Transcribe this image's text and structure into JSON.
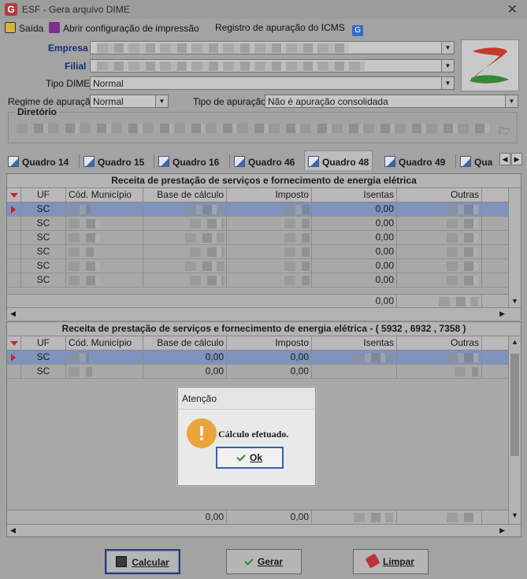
{
  "window": {
    "title": "ESF - Gera arquivo DIME",
    "close_symbol": "✕"
  },
  "toolbar": {
    "exit_label": "Saída",
    "print_config_label": "Abrir configuração de impressão",
    "icms_register_label": "Registro de apuração do ICMS"
  },
  "form": {
    "empresa_label": "Empresa",
    "filial_label": "Filial",
    "tipo_dime_label": "Tipo DIME",
    "tipo_dime_value": "Normal",
    "regime_label": "Regime de apuração",
    "regime_value": "Normal",
    "tipo_apuracao_label": "Tipo de apuração",
    "tipo_apuracao_value": "Não é apuração consolidada",
    "diretorio_label": "Diretório"
  },
  "tabs": [
    {
      "label": "Quadro 14"
    },
    {
      "label": "Quadro 15"
    },
    {
      "label": "Quadro 16"
    },
    {
      "label": "Quadro 46"
    },
    {
      "label": "Quadro 48",
      "active": true
    },
    {
      "label": "Quadro 49"
    },
    {
      "label": "Qua"
    }
  ],
  "grid1": {
    "title": "Receita de prestação de serviços e fornecimento de energia elétrica",
    "columns": [
      "UF",
      "Cód. Município",
      "Base de cálculo",
      "Imposto",
      "Isentas",
      "Outras"
    ],
    "rows": [
      {
        "uf": "SC",
        "isentas": "0,00"
      },
      {
        "uf": "SC",
        "isentas": "0,00"
      },
      {
        "uf": "SC",
        "isentas": "0,00"
      },
      {
        "uf": "SC",
        "isentas": "0,00"
      },
      {
        "uf": "SC",
        "isentas": "0,00"
      },
      {
        "uf": "SC",
        "isentas": "0,00"
      }
    ],
    "total_isentas": "0,00"
  },
  "grid2": {
    "title": "Receita de prestação de serviços e fornecimento de energia elétrica - ( 5932 , 6932 , 7358 )",
    "columns": [
      "UF",
      "Cód. Município",
      "Base de cálculo",
      "Imposto",
      "Isentas",
      "Outras"
    ],
    "rows": [
      {
        "uf": "SC",
        "base": "0,00",
        "imposto": "0,00"
      },
      {
        "uf": "SC",
        "base": "0,00",
        "imposto": "0,00"
      }
    ],
    "total_base": "0,00",
    "total_imposto": "0,00"
  },
  "dialog": {
    "title": "Atenção",
    "message": "Cálculo efetuado.",
    "ok_label": "Ok"
  },
  "buttons": {
    "calcular_label": "Calcular",
    "gerar_label": "Gerar",
    "limpar_label": "Limpar"
  },
  "colors": {
    "selected_row": "#7f93bd",
    "label_blue": "#162f7a",
    "indicator_red": "#c0262b"
  }
}
